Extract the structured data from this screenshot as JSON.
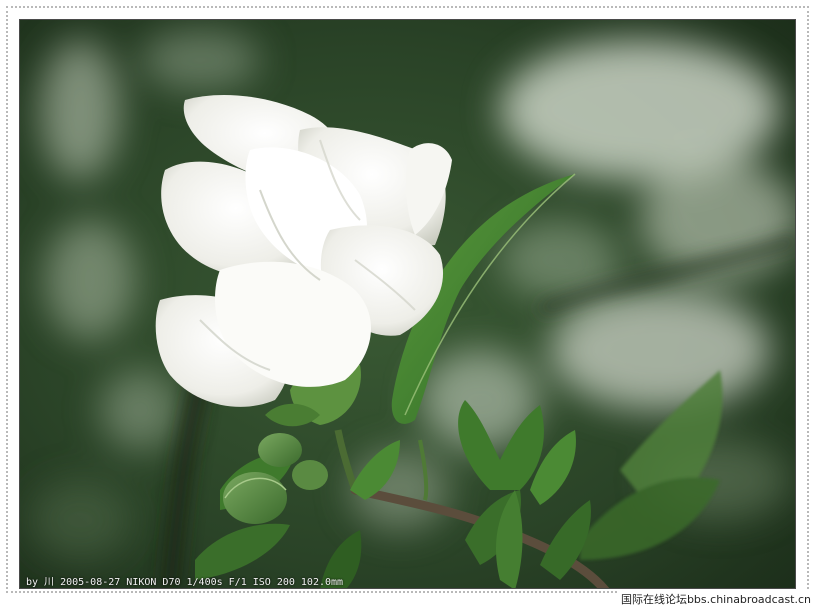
{
  "photo": {
    "caption": "by 川 2005-08-27  NIKON D70 1/400s F/1 ISO 200 102.0mm",
    "watermark": "国际在线论坛bbs.chinabroadcast.cn"
  },
  "colors": {
    "background_green": "#2c4a2c",
    "petal_white": "#f3f3ee",
    "leaf_green": "#3e7a2e",
    "frame_border": "#b9b9b9"
  }
}
